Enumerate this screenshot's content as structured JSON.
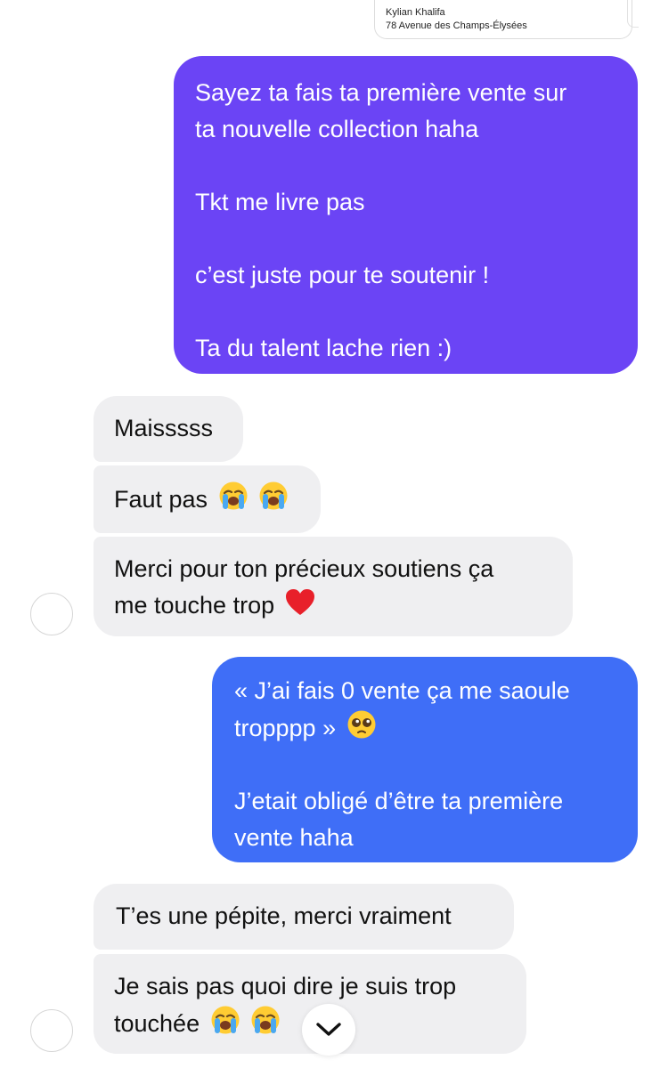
{
  "shared_card": {
    "name": "Kylian Khalifa",
    "address": "78 Avenue des Champs-Élysées"
  },
  "messages": [
    {
      "direction": "outgoing",
      "color": "#6b44f5",
      "lines": [
        "Sayez ta fais ta première vente sur",
        "ta nouvelle collection haha",
        "",
        "Tkt me livre pas",
        "",
        "c’est juste pour te soutenir !",
        "",
        "Ta du talent lache rien :)"
      ]
    },
    {
      "direction": "incoming",
      "text": "Maisssss"
    },
    {
      "direction": "incoming",
      "text": "Faut pas",
      "emoji": [
        "loudly-crying-face",
        "loudly-crying-face"
      ]
    },
    {
      "direction": "incoming",
      "lines": [
        "Merci pour ton précieux soutiens ça",
        "me touche trop"
      ],
      "emoji": [
        "red-heart"
      ]
    },
    {
      "direction": "outgoing",
      "color": "#3f6ef7",
      "lines": [
        "« J’ai fais 0 vente ça me saoule",
        "tropppp »",
        "",
        "J’etait obligé d’être ta première",
        "vente haha"
      ],
      "emoji": [
        "pleading-face"
      ]
    },
    {
      "direction": "incoming",
      "text": "T’es une pépite, merci vraiment"
    },
    {
      "direction": "incoming",
      "lines": [
        "Je sais pas quoi dire je suis trop",
        "touchée"
      ],
      "emoji": [
        "loudly-crying-face",
        "loudly-crying-face"
      ]
    }
  ],
  "scroll_button": {
    "icon": "chevron-down-icon"
  }
}
